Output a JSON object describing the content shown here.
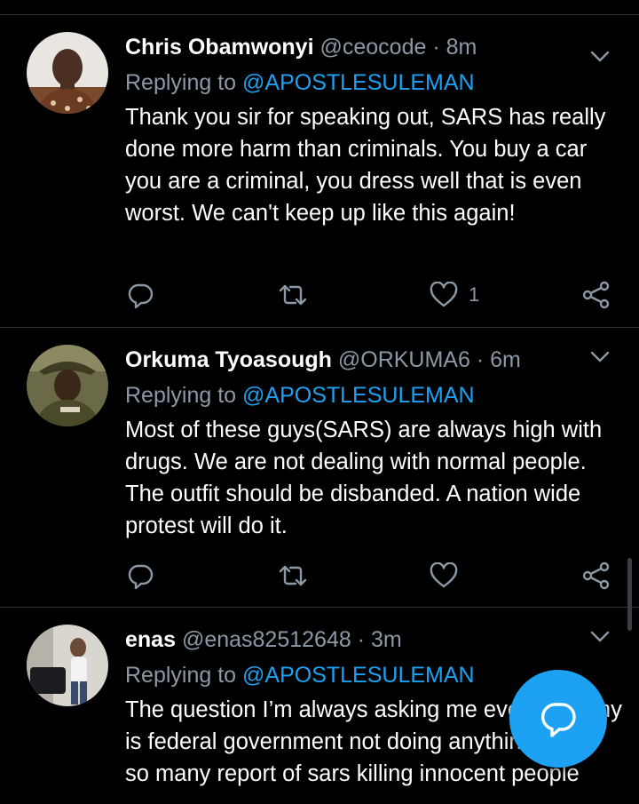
{
  "colors": {
    "background": "#000000",
    "text": "#ffffff",
    "muted": "#8b98a5",
    "accent": "#1da1f2",
    "divider": "#2f3336"
  },
  "tweets": [
    {
      "name": "Chris Obamwonyi",
      "handle": "@ceocode",
      "separator": "·",
      "time": "8m",
      "replying_label": "Replying to",
      "replying_to": "@APOSTLESULEMAN",
      "text": "Thank you sir for speaking out, SARS has really done more harm than criminals. You buy a car you are a criminal, you dress well that is even worst. We can't keep up like this again!",
      "like_count": "1",
      "icons": [
        "reply-icon",
        "retweet-icon",
        "like-icon",
        "share-icon"
      ]
    },
    {
      "name": "Orkuma Tyoasough",
      "handle": "@ORKUMA6",
      "separator": "·",
      "time": "6m",
      "replying_label": "Replying to",
      "replying_to": "@APOSTLESULEMAN",
      "text": "Most of these guys(SARS) are always high with drugs. We are not dealing with normal people. The outfit should be disbanded. A nation wide protest will do it.",
      "like_count": "",
      "icons": [
        "reply-icon",
        "retweet-icon",
        "like-icon",
        "share-icon"
      ]
    },
    {
      "name": "enas",
      "handle": "@enas82512648",
      "separator": "·",
      "time": "3m",
      "replying_label": "Replying to",
      "replying_to": "@APOSTLESULEMAN",
      "text": "The question I’m always asking me everyday why is federal government not doing anything about so many report of sars killing innocent people",
      "like_count": ""
    }
  ],
  "fab": {
    "icon": "compose-reply-icon"
  }
}
